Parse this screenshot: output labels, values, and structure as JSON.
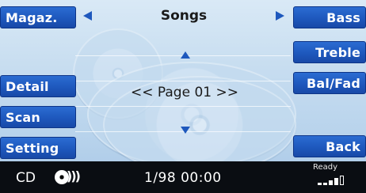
{
  "header": {
    "title": "Songs"
  },
  "left_softkeys": [
    {
      "label": "Magaz."
    },
    {
      "label": "Detail"
    },
    {
      "label": "Scan"
    },
    {
      "label": "Setting"
    }
  ],
  "right_softkeys": [
    {
      "label": "Bass"
    },
    {
      "label": "Treble"
    },
    {
      "label": "Bal/Fad"
    },
    {
      "label": "Back"
    }
  ],
  "list": {
    "page_text": "<< Page 01 >>"
  },
  "status_bar": {
    "source": "CD",
    "track_time": "1/98 00:00",
    "ready_text": "Ready",
    "signal_bars_filled": 4,
    "signal_bars_total": 5
  },
  "colors": {
    "softkey_blue": "#1e58bd",
    "background_light_blue": "#c7ddf0",
    "status_bar": "#0a0d12"
  },
  "icons": [
    "left-triangle-icon",
    "right-triangle-icon",
    "up-arrow-icon",
    "down-arrow-icon",
    "cd-disc-icon",
    "signal-bars-icon"
  ]
}
